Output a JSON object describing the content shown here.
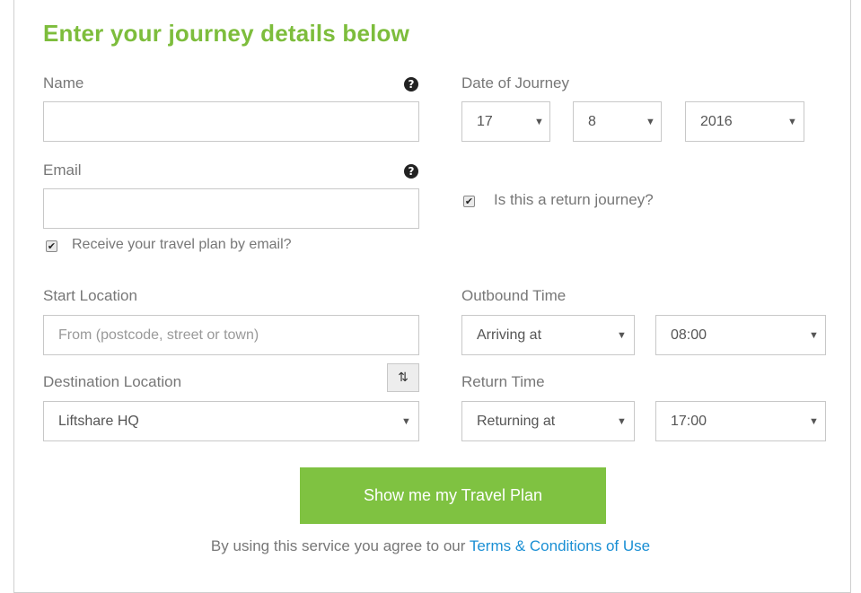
{
  "form": {
    "title": "Enter your journey details below",
    "name_label": "Name",
    "name_value": "",
    "email_label": "Email",
    "email_value": "",
    "email_checkbox_label": "Receive your travel plan by email?",
    "email_checkbox_checked": true,
    "date_label": "Date of Journey",
    "date_day": "17",
    "date_month": "8",
    "date_year": "2016",
    "return_checkbox_label": "Is this a return journey?",
    "return_checkbox_checked": true,
    "start_label": "Start Location",
    "start_placeholder": "From (postcode, street or town)",
    "destination_label": "Destination Location",
    "destination_value": "Liftshare HQ",
    "outbound_label": "Outbound Time",
    "outbound_mode": "Arriving at",
    "outbound_time": "08:00",
    "return_label": "Return Time",
    "return_mode": "Returning at",
    "return_time": "17:00",
    "submit_label": "Show me my Travel Plan",
    "terms_prefix": "By using this service you agree to our",
    "terms_link": "Terms & Conditions of Use"
  },
  "icons": {
    "help": "question-circle-icon",
    "caret": "caret-down-icon",
    "swap": "swap-vertical-icon",
    "check": "checkmark-icon"
  },
  "colors": {
    "accent": "#7dbd3c",
    "button": "#7fc241",
    "link": "#1a8fd4"
  }
}
